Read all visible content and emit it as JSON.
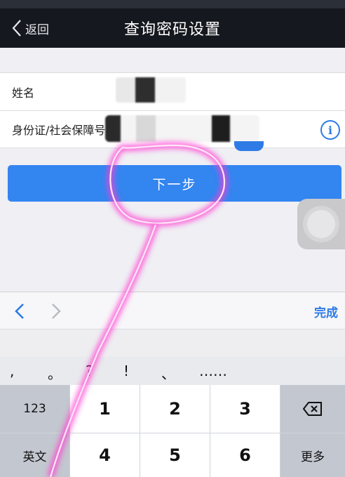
{
  "nav": {
    "back_label": "返回",
    "title": "查询密码设置"
  },
  "form": {
    "name_label": "姓名",
    "id_label": "身份证/社会保障号"
  },
  "next_button": "下一步",
  "keyboard": {
    "done_label": "完成",
    "punctuation": [
      ",",
      "。",
      "?",
      "!",
      "、",
      "……"
    ],
    "rows": [
      [
        "123",
        "1",
        "2",
        "3",
        "delete"
      ],
      [
        "英文",
        "4",
        "5",
        "6",
        "更多"
      ]
    ]
  },
  "colors": {
    "accent": "#3385f0",
    "nav_bg": "#16181f",
    "annotation": "#ff3cd2"
  },
  "icons": [
    "chevron-left-icon",
    "info-icon",
    "chevron-left-icon",
    "chevron-right-icon",
    "backspace-icon",
    "assistive-touch-icon"
  ]
}
